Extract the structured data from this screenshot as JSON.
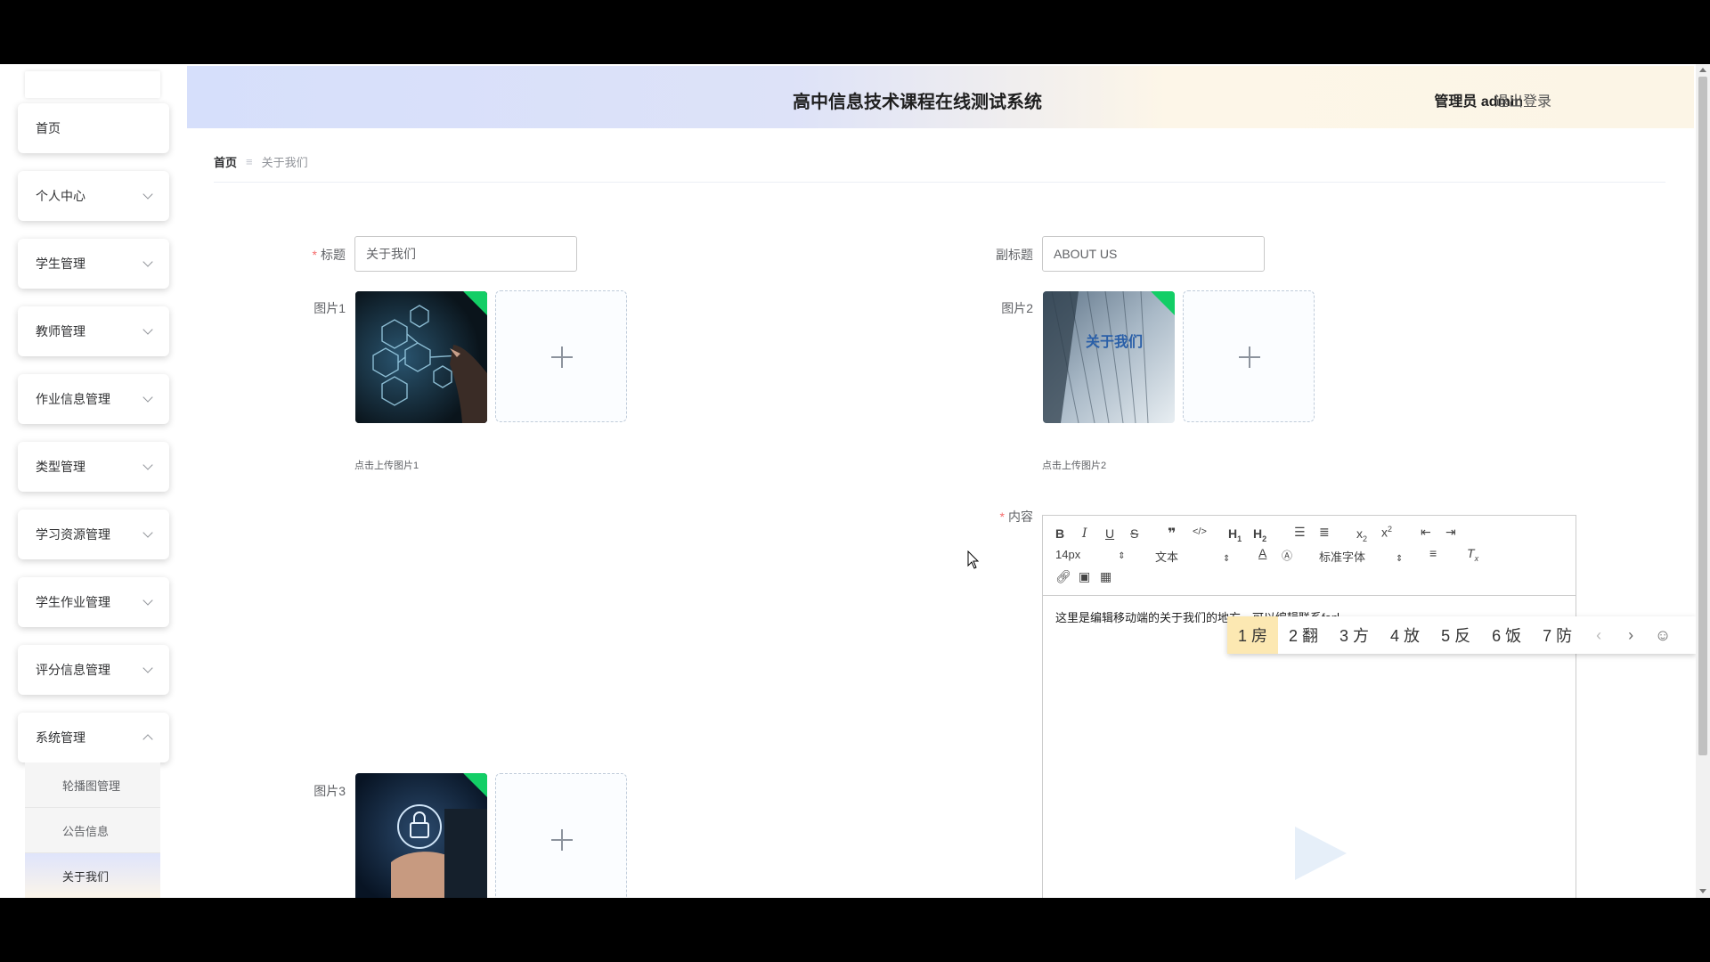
{
  "header": {
    "title": "高中信息技术课程在线测试系统",
    "user": "管理员 admin",
    "logout": "退出登录"
  },
  "sidebar": {
    "items": [
      {
        "label": "首页"
      },
      {
        "label": "个人中心"
      },
      {
        "label": "学生管理"
      },
      {
        "label": "教师管理"
      },
      {
        "label": "作业信息管理"
      },
      {
        "label": "类型管理"
      },
      {
        "label": "学习资源管理"
      },
      {
        "label": "学生作业管理"
      },
      {
        "label": "评分信息管理"
      },
      {
        "label": "系统管理"
      }
    ],
    "submenu": [
      {
        "label": "轮播图管理"
      },
      {
        "label": "公告信息"
      },
      {
        "label": "关于我们"
      }
    ]
  },
  "breadcrumb": {
    "home": "首页",
    "sep": "≡",
    "current": "关于我们"
  },
  "form": {
    "title_label": "标题",
    "title_value": "关于我们",
    "subtitle_label": "副标题",
    "subtitle_value": "ABOUT US",
    "pic1_label": "图片1",
    "pic1_hint": "点击上传图片1",
    "pic2_label": "图片2",
    "pic2_hint": "点击上传图片2",
    "pic3_label": "图片3",
    "content_label": "内容",
    "pic2_overlay_text": "关于我们"
  },
  "editor": {
    "font_size": "14px",
    "block_type": "文本",
    "font_family": "标准字体",
    "content": "这里是编辑移动端的关于我们的地方，可以编辑联系fan"
  },
  "ime": {
    "candidates": [
      "1 房",
      "2 翻",
      "3 方",
      "4 放",
      "5 反",
      "6 饭",
      "7 防"
    ],
    "selected_index": 0
  },
  "colors": {
    "accent_blue": "#d6dffb",
    "accent_cream": "#fcf5e6",
    "success_corner": "#13ce66",
    "required": "#f56c6c"
  }
}
